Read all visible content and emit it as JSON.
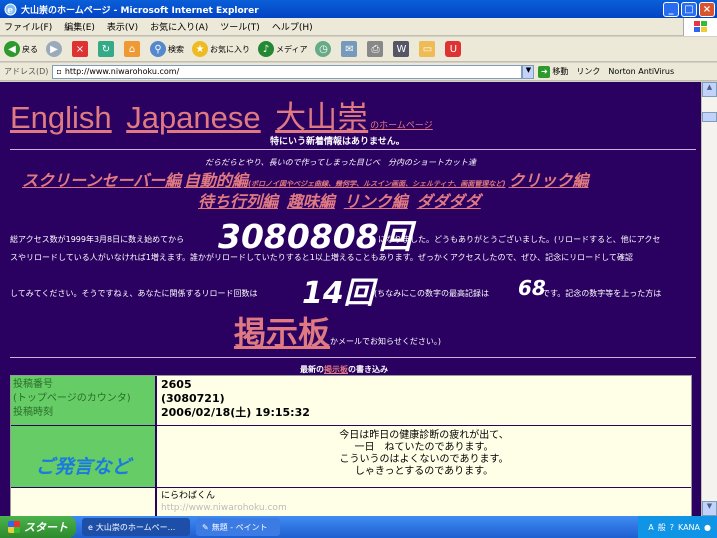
{
  "window": {
    "title": "大山崇のホームページ - Microsoft Internet Explorer",
    "min": "_",
    "max": "□",
    "close": "×"
  },
  "menu": [
    "ファイル(F)",
    "編集(E)",
    "表示(V)",
    "お気に入り(A)",
    "ツール(T)",
    "ヘルプ(H)"
  ],
  "toolbar": {
    "back": "戻る",
    "search": "検索",
    "favorites": "お気に入り",
    "media": "メディア"
  },
  "address": {
    "label": "アドレス(D)",
    "url": "http://www.niwarohoku.com/",
    "go": "移動",
    "links": "リンク",
    "norton": "Norton AntiVirus"
  },
  "page": {
    "title_en": "English",
    "title_jp": "Japanese",
    "title_name": "大山崇",
    "title_home": "のホームページ",
    "no_news": "特にいう新着情報はありません。",
    "intro": "だらだらとやり、長いので作ってしまった目じべ　分内のショートカット達",
    "nav1": {
      "screensaver": "スクリーンセーバー編",
      "jidou": "自動的編",
      "jidou_sub": "(ボロノイ図やベジェ曲線、幾何学、ルスイン画面、シェルティナ、画面管理など)",
      "click": "クリック編"
    },
    "nav2": {
      "matrix": "待ち行列編",
      "hobby": "趣味編",
      "link": "リンク編",
      "dadada": "ダダダダ"
    },
    "counter_pre": "総アクセス数が1999年3月8日に数え始めてから",
    "counter_value": "3080808回",
    "counter_post": "になりました。どうもありがとうございました。(リロードすると、他にアクセ",
    "reload_line": "スやリロードしている人がいなければ1増えます。誰かがリロードしていたりすると1以上増えることもあります。ぜっかくアクセスしたので、ぜひ、記念にリロードして確認",
    "reload_pre": "してみてください。そうですねぇ、あなたに関係するリロード回数は",
    "reload_value": "14回",
    "reload_mid": "(ちなみにこの数字の最高記録は",
    "reload_record": "68",
    "reload_post": "です。記念の数字等を上った方は",
    "bbs": "掲示板",
    "bbs_note": "かメールでお知らせください。)",
    "latest_pre": "最新の",
    "latest_link": "掲示板",
    "latest_post": "の書き込み"
  },
  "post": {
    "label_no": "投稿番号",
    "label_counter": "(トップページのカウンタ)",
    "label_time": "投稿時刻",
    "no": "2605",
    "counter": "(3080721)",
    "time": "2006/02/18(土) 19:15:32",
    "comment_label": "ご発言など",
    "body": [
      "今日は昨日の健康診断の疲れが出て、",
      "一日　ねていたのであります。",
      "こういうのはよくないのであります。",
      "しゃきっとするのであります。"
    ],
    "name": "にらわばくん",
    "url": "http://www.niwarohoku.com"
  },
  "taskbar": {
    "start": "スタート",
    "task1": "大山崇のホームペー...",
    "task2": "無題 - ペイント",
    "tray": [
      "A",
      "般",
      "?",
      "KANA"
    ]
  }
}
